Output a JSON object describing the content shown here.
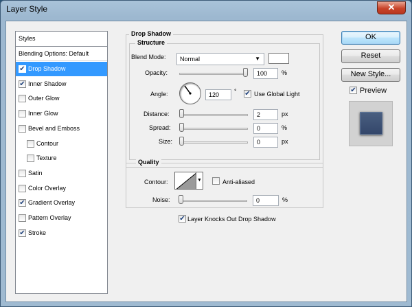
{
  "window": {
    "title": "Layer Style",
    "close": "✕"
  },
  "styles": {
    "header": "Styles",
    "blending_options": "Blending Options: Default",
    "items": [
      {
        "label": "Drop Shadow",
        "checked": true,
        "selected": true
      },
      {
        "label": "Inner Shadow",
        "checked": true
      },
      {
        "label": "Outer Glow",
        "checked": false
      },
      {
        "label": "Inner Glow",
        "checked": false
      },
      {
        "label": "Bevel and Emboss",
        "checked": false
      },
      {
        "label": "Contour",
        "checked": false,
        "sub": true
      },
      {
        "label": "Texture",
        "checked": false,
        "sub": true
      },
      {
        "label": "Satin",
        "checked": false
      },
      {
        "label": "Color Overlay",
        "checked": false
      },
      {
        "label": "Gradient Overlay",
        "checked": true
      },
      {
        "label": "Pattern Overlay",
        "checked": false
      },
      {
        "label": "Stroke",
        "checked": true
      }
    ]
  },
  "drop_shadow": {
    "title": "Drop Shadow",
    "structure": {
      "title": "Structure",
      "blend_mode_label": "Blend Mode:",
      "blend_mode_value": "Normal",
      "opacity_label": "Opacity:",
      "opacity_value": "100",
      "opacity_unit": "%",
      "opacity_level": 1.0,
      "angle_label": "Angle:",
      "angle_value": "120",
      "angle_unit": "°",
      "use_global_light_label": "Use Global Light",
      "use_global_light_checked": true,
      "distance_label": "Distance:",
      "distance_value": "2",
      "distance_unit": "px",
      "spread_label": "Spread:",
      "spread_value": "0",
      "spread_unit": "%",
      "size_label": "Size:",
      "size_value": "0",
      "size_unit": "px"
    },
    "quality": {
      "title": "Quality",
      "contour_label": "Contour:",
      "anti_aliased_label": "Anti-aliased",
      "anti_aliased_checked": false,
      "noise_label": "Noise:",
      "noise_value": "0",
      "noise_unit": "%"
    },
    "knockout_label": "Layer Knocks Out Drop Shadow",
    "knockout_checked": true
  },
  "buttons": {
    "ok": "OK",
    "reset": "Reset",
    "new_style": "New Style...",
    "preview": "Preview",
    "preview_checked": true
  },
  "colors": {
    "selection": "#3399ff",
    "close": "#c8442a",
    "preview_swatch": "#3f5477"
  }
}
